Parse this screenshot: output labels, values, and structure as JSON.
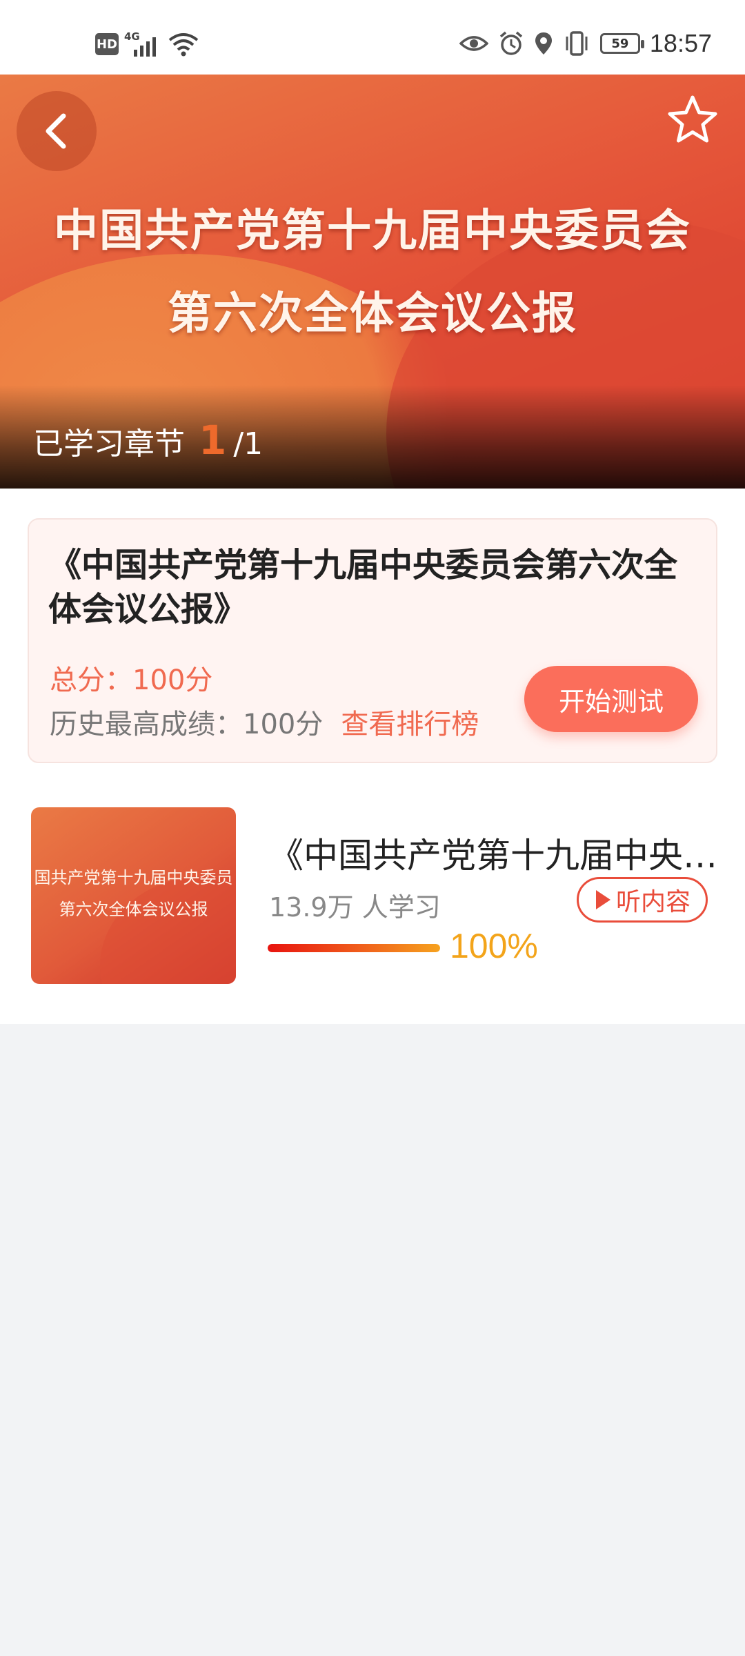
{
  "status_bar": {
    "hd": "HD",
    "network": "4G",
    "battery": "59",
    "time": "18:57",
    "icons": [
      "hd-icon",
      "signal-icon",
      "wifi-icon",
      "eye-icon",
      "alarm-icon",
      "location-icon",
      "vibrate-icon",
      "battery-icon"
    ]
  },
  "hero": {
    "title_line1": "中国共产党第十九届中央委员会",
    "title_line2": "第六次全体会议公报",
    "progress_label": "已学习章节",
    "progress_done": "1",
    "progress_total": "/1"
  },
  "quiz": {
    "title": "《中国共产党第十九届中央委员会第六次全体会议公报》",
    "total_score": "总分：100分",
    "best_label": "历史最高成绩：100分",
    "rank_link": "查看排行榜",
    "start_button": "开始测试"
  },
  "course": {
    "thumb_line1": "国共产党第十九届中央委员",
    "thumb_line2": "第六次全体会议公报",
    "title": "《中国共产党第十九届中央委员会第六次全体会议公报》",
    "learners": "13.9万 人学习",
    "listen_button": "听内容",
    "progress_percent": "100%",
    "progress_value": 100
  },
  "colors": {
    "accent": "#fb6e5b",
    "accent_text": "#f06a50",
    "progress_text": "#f3a41a",
    "listen_border": "#e94d3b"
  }
}
